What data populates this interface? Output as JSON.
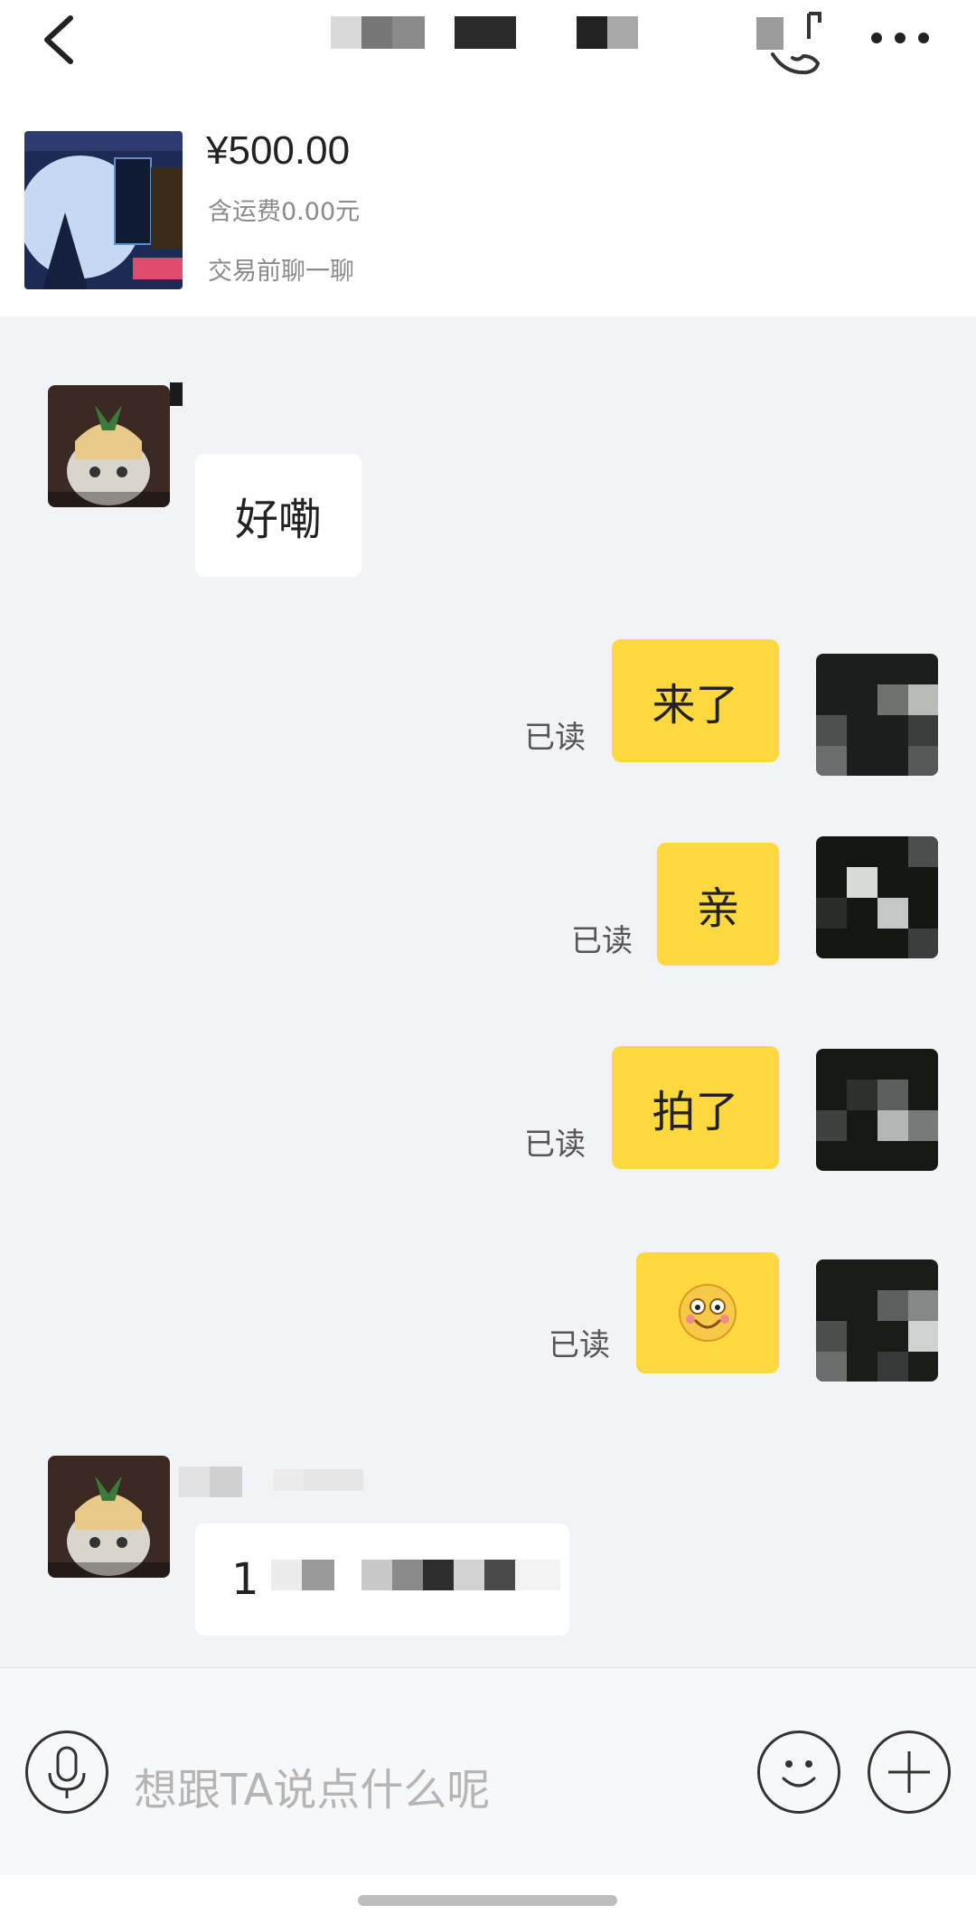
{
  "header": {
    "back_icon": "chevron-left-icon",
    "title_redacted": true,
    "more_icon": "more-dots-icon"
  },
  "product": {
    "price": "¥500.00",
    "shipping": "含运费0.00元",
    "chat_note": "交易前聊一聊"
  },
  "messages": [
    {
      "side": "left",
      "text": "好嘞"
    },
    {
      "side": "right",
      "text": "来了",
      "status": "已读"
    },
    {
      "side": "right",
      "text": "亲",
      "status": "已读"
    },
    {
      "side": "right",
      "text": "拍了",
      "status": "已读"
    },
    {
      "side": "right",
      "emoji": "smiling-face-emoji",
      "status": "已读"
    },
    {
      "side": "left",
      "text_visible_prefix": "1",
      "redacted": true
    }
  ],
  "input": {
    "placeholder": "想跟TA说点什么呢",
    "voice_icon": "microphone-icon",
    "emoji_icon": "smiley-icon",
    "plus_icon": "plus-icon"
  },
  "colors": {
    "accent_yellow": "#fdd83e",
    "chat_bg": "#f2f3f7"
  }
}
